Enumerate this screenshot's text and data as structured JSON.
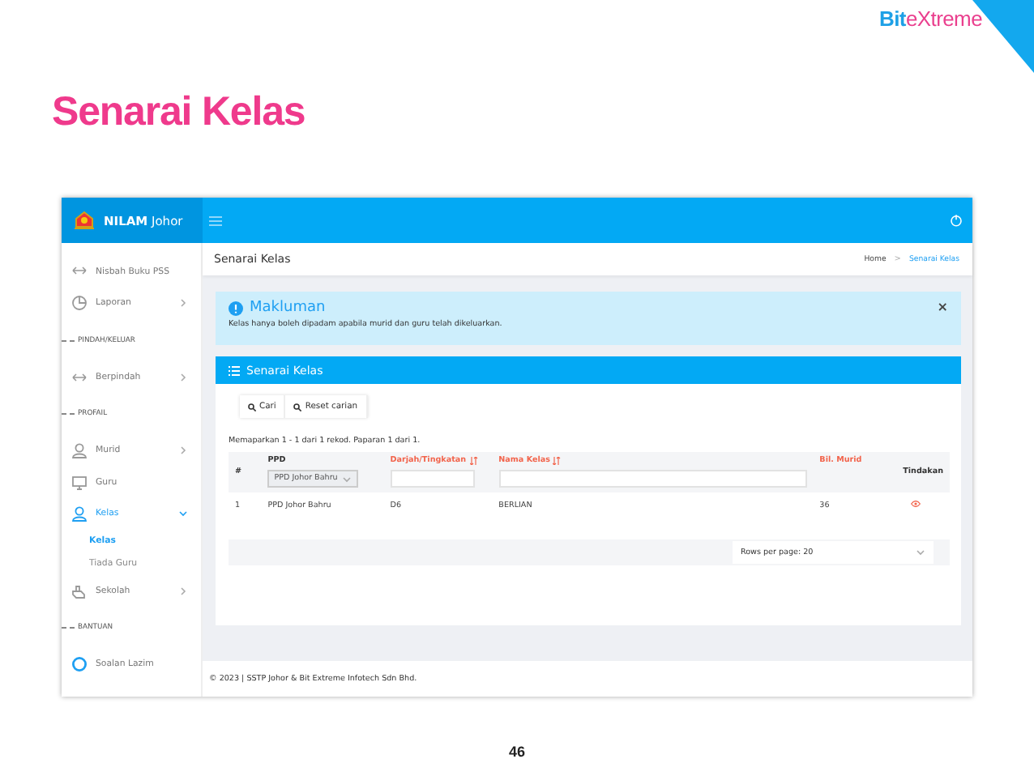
{
  "slide": {
    "title": "Senarai Kelas",
    "logo": [
      "Bit",
      "eXtreme"
    ],
    "page_number": "46"
  },
  "app": {
    "brand": "**NILAM** Johor",
    "sidebar": {
      "items": [
        {
          "kind": "item",
          "label": "Nisbah Buku PSS",
          "has_submenu": false,
          "selected": false
        },
        {
          "kind": "item",
          "label": "Laporan",
          "has_submenu": true,
          "expanded": false,
          "selected": false
        },
        {
          "kind": "section",
          "label": "PINDAH/KELUAR"
        },
        {
          "kind": "item",
          "label": "Berpindah",
          "has_submenu": true,
          "expanded": false,
          "selected": false
        },
        {
          "kind": "section",
          "label": "PROFAIL"
        },
        {
          "kind": "item",
          "label": "Murid",
          "has_submenu": true,
          "expanded": false,
          "selected": false
        },
        {
          "kind": "item",
          "label": "Guru",
          "has_submenu": false,
          "selected": false
        },
        {
          "kind": "item",
          "label": "Kelas",
          "has_submenu": true,
          "expanded": true,
          "selected": true,
          "children": [
            {
              "label": "Kelas",
              "selected": true
            },
            {
              "label": "Tiada Guru",
              "selected": false
            }
          ]
        },
        {
          "kind": "item",
          "label": "Sekolah",
          "has_submenu": true,
          "expanded": false,
          "selected": false
        },
        {
          "kind": "section",
          "label": "BANTUAN"
        },
        {
          "kind": "item",
          "label": "Soalan Lazim",
          "has_submenu": false,
          "selected": false
        }
      ]
    },
    "page_title": "Senarai Kelas",
    "breadcrumb_separator": ">",
    "breadcrumb": [
      {
        "label": "Home",
        "selected": false
      },
      {
        "label": "Senarai Kelas",
        "selected": true
      }
    ],
    "alert": {
      "title": "Makluman",
      "text": "Kelas hanya boleh dipadam apabila murid dan guru telah dikeluarkan.",
      "close": "×"
    },
    "card": {
      "title": "Senarai Kelas",
      "buttons": [
        "Cari",
        "Reset carian"
      ],
      "summary": "Memaparkan 1 - 1 dari 1 rekod. Paparan 1 dari 1.",
      "table": {
        "columns": [
          {
            "label": "#",
            "sortable": false,
            "sort_indicator": false
          },
          {
            "label": "PPD",
            "sortable": false,
            "sort_indicator": false
          },
          {
            "label": "Darjah/Tingkatan",
            "sortable": true,
            "sort_indicator": true
          },
          {
            "label": "Nama Kelas",
            "sortable": true,
            "sort_indicator": true
          },
          {
            "label": "Bil. Murid",
            "sortable": true,
            "sort_indicator": false
          },
          {
            "label": "Tindakan",
            "sortable": false,
            "sort_indicator": false
          }
        ],
        "filters": [
          {
            "kind": "select",
            "value": "PPD Johor Bahru"
          },
          {
            "kind": "text"
          },
          {
            "kind": "text"
          }
        ],
        "rows": [
          [
            "1",
            "PPD Johor Bahru",
            "D6",
            "BERLIAN",
            "36"
          ]
        ]
      },
      "pager": "Rows per page: 20"
    },
    "footer": "© 2023 | SSTP Johor & Bit Extreme Infotech Sdn Bhd."
  }
}
